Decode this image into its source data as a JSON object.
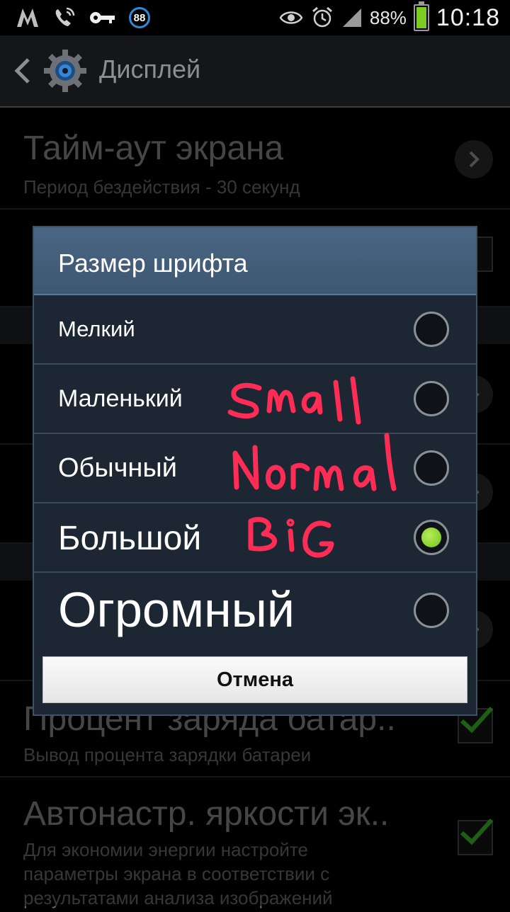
{
  "status_bar": {
    "battery_percent": "88%",
    "time": "10:18",
    "badge": "88",
    "battery_level": 0.88
  },
  "action_bar": {
    "title": "Дисплей"
  },
  "settings": {
    "screen_timeout": {
      "title": "Тайм-аут экрана",
      "subtitle": "Период бездействия - 30 секунд"
    },
    "battery_percent": {
      "title": "Процент заряда батар..",
      "subtitle": "Вывод процента зарядки батареи"
    },
    "auto_brightness": {
      "title": "Автонастр. яркости эк..",
      "subtitle_lines": [
        "Для экономии энергии настройте",
        "параметры экрана в соответствии с",
        "результатами анализа изображений"
      ]
    }
  },
  "dialog": {
    "title": "Размер шрифта",
    "options": [
      {
        "label": "Мелкий",
        "selected": false
      },
      {
        "label": "Маленький",
        "selected": false
      },
      {
        "label": "Обычный",
        "selected": false
      },
      {
        "label": "Большой",
        "selected": true
      },
      {
        "label": "Огромный",
        "selected": false
      }
    ],
    "cancel_label": "Отмена"
  },
  "annotations": {
    "small": "Small",
    "normal": "Normal",
    "big": "BiG",
    "color": "#ff2d55"
  },
  "colors": {
    "dialog_header": "#4a6684",
    "radio_selected": "#7ccb22",
    "checkmark": "#3fbf2a"
  }
}
